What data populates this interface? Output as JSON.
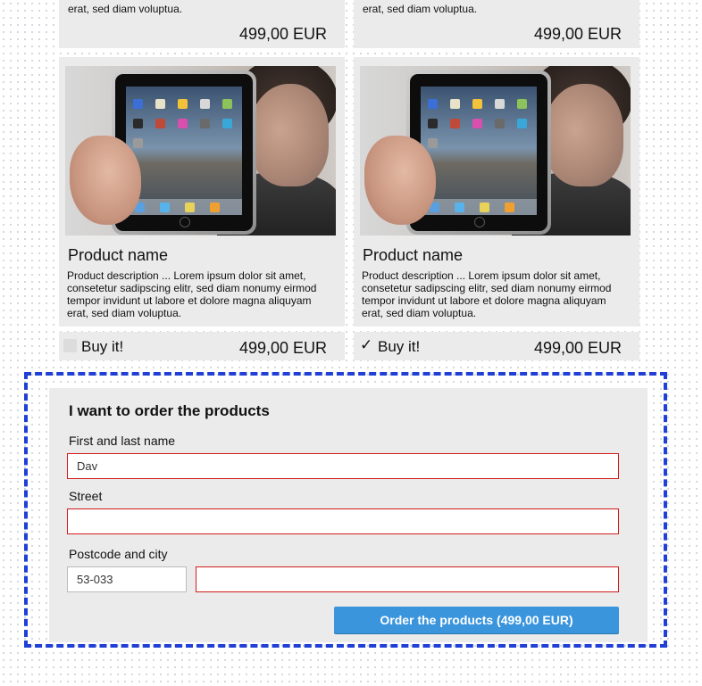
{
  "products_top": [
    {
      "desc_tail": "erat, sed diam voluptua.",
      "price": "499,00 EUR"
    },
    {
      "desc_tail": "erat, sed diam voluptua.",
      "price": "499,00 EUR"
    }
  ],
  "products": [
    {
      "name": "Product name",
      "description": "Product description  ... Lorem ipsum dolor sit amet, consetetur sadipscing elitr, sed diam nonumy eirmod tempor invidunt ut labore et dolore magna aliquyam erat, sed diam voluptua.",
      "buy_label": "Buy it!",
      "checked": false,
      "checkmark": "",
      "price": "499,00 EUR"
    },
    {
      "name": "Product name",
      "description": "Product description  ... Lorem ipsum dolor sit amet, consetetur sadipscing elitr, sed diam nonumy eirmod tempor invidunt ut labore et dolore magna aliquyam erat, sed diam voluptua.",
      "buy_label": "Buy it!",
      "checked": true,
      "checkmark": "✓",
      "price": "499,00 EUR"
    }
  ],
  "order_form": {
    "title": "I want to order the products",
    "name_label": "First and last name",
    "name_value": "Dav",
    "street_label": "Street",
    "street_value": "",
    "postcode_city_label": "Postcode and city",
    "postcode_value": "53-033",
    "city_value": "",
    "submit_label": "Order the products (499,00 EUR)"
  },
  "colors": {
    "accent": "#3a95dd",
    "error_border": "#d21c1c",
    "frame": "#1f3fd6",
    "panel": "#ebebeb"
  }
}
